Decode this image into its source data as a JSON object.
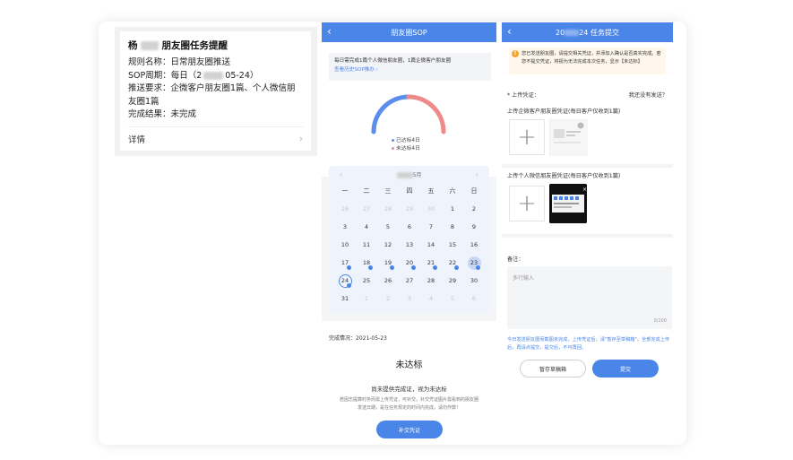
{
  "reminder": {
    "title": "朋友圈任务提醒",
    "rows": [
      "规则名称：日常朋友圈推送",
      "SOP周期：每日（2",
      "05-24）",
      "推送要求：企微客户朋友圈1篇、个人微信朋",
      "友圈1篇",
      "完成结果：未完成"
    ],
    "detail": "详情",
    "chevron": "›"
  },
  "sop": {
    "nav_title": "朋友圈SOP",
    "back": "‹",
    "notice": "每日需完成1篇个人微信朋友圈，1篇企微客户朋友圈",
    "notice_link": "查看历史SOP推办 ›",
    "legend_done": "已达标4日",
    "legend_undone": "未达标4日",
    "colors": {
      "done": "#5b8def",
      "undone": "#ef8a8a"
    },
    "month_suffix": "5月",
    "prev": "‹",
    "next": "›",
    "weekdays": [
      "一",
      "二",
      "三",
      "四",
      "五",
      "六",
      "日"
    ],
    "days": [
      "26",
      "27",
      "28",
      "29",
      "30",
      "1",
      "2",
      "3",
      "4",
      "5",
      "6",
      "7",
      "8",
      "9",
      "10",
      "11",
      "12",
      "13",
      "14",
      "15",
      "16",
      "17",
      "18",
      "19",
      "20",
      "21",
      "22",
      "23",
      "24",
      "25",
      "26",
      "27",
      "28",
      "29",
      "30",
      "31",
      "1",
      "2",
      "3",
      "4",
      "5",
      "6"
    ],
    "result_date": "完成情况：2021-05-23",
    "status": "未达标",
    "status_desc": "尚未提供完成证，视为未达标",
    "status_note": "若因忘提算时务而需上传凭证，可补交。补交凭证图片需看到的朋友圈发送日期，是在任务规定的时间内完成，请勿作弊！",
    "button": "补交凭证"
  },
  "task": {
    "nav_title_prefix": "20",
    "nav_title_suffix": "24 任务提交",
    "back": "‹",
    "warn_icon": "!",
    "warning": "您已发送朋友圈，请提交相关凭证，并添加入确认是否真实完成。若您不提交凭证，将视为无法完成本次任务，显示【未达标】",
    "upload_label": "* 上传凭证：",
    "no_post": "我还没有发送？",
    "label_enterprise": "上传企微客户朋友圈凭证(每日客户仅收到1篇)",
    "label_personal": "上传个人微信朋友圈凭证(每日客户仅收到1篇)",
    "plus": "+",
    "remark_label": "备注：",
    "textarea_placeholder": "多行输入",
    "counter": "0/100",
    "tip": "今日发送朋友圈而截图未完成，上传凭证后，请\"暂存至草稿箱\"。全部完成上传后，再请点提交，提交后，不可再回。",
    "draft_button": "暂存草稿箱",
    "submit_button": "提交"
  }
}
